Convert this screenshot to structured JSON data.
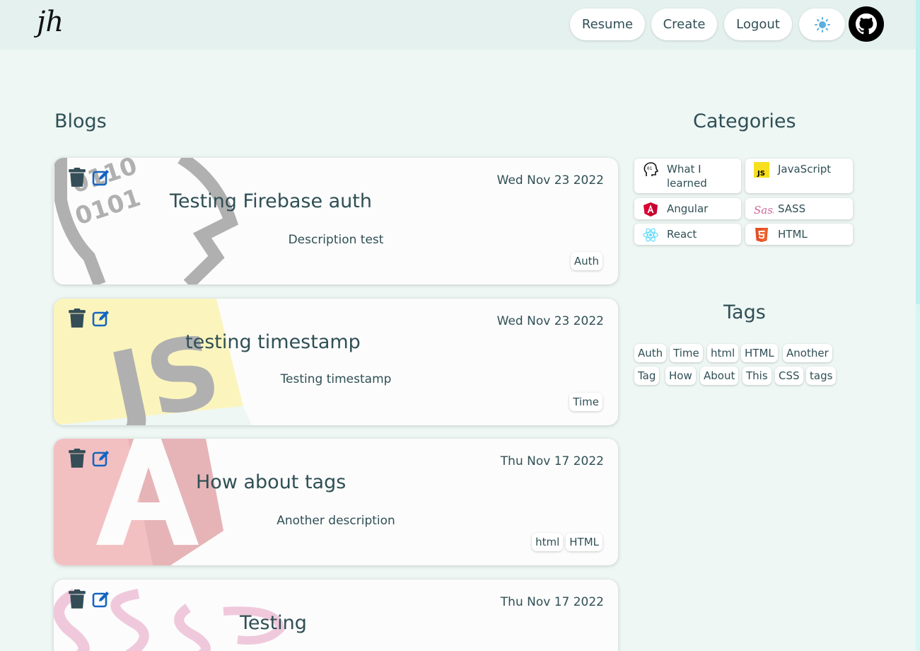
{
  "header": {
    "logo_text": "jh",
    "nav": [
      "Resume",
      "Create",
      "Logout"
    ],
    "theme_icon": "sun-icon",
    "github_icon": "github-icon"
  },
  "blogs": {
    "heading": "Blogs",
    "posts": [
      {
        "title": "Testing Firebase auth",
        "date": "Wed Nov 23 2022",
        "description": "Description test",
        "tags": [
          "Auth"
        ],
        "category": "What I learned"
      },
      {
        "title": "testing timestamp",
        "date": "Wed Nov 23 2022",
        "description": "Testing timestamp",
        "tags": [
          "Time"
        ],
        "category": "JavaScript"
      },
      {
        "title": "How about tags",
        "date": "Thu Nov 17 2022",
        "description": "Another description",
        "tags": [
          "html",
          "HTML"
        ],
        "category": "Angular"
      },
      {
        "title": "Testing",
        "date": "Thu Nov 17 2022",
        "description": "",
        "tags": [],
        "category": "SASS"
      }
    ]
  },
  "categories": {
    "heading": "Categories",
    "items": [
      {
        "label": "What I learned",
        "icon": "brain-head-icon"
      },
      {
        "label": "JavaScript",
        "icon": "javascript-icon"
      },
      {
        "label": "Angular",
        "icon": "angular-icon"
      },
      {
        "label": "SASS",
        "icon": "sass-icon"
      },
      {
        "label": "React",
        "icon": "react-icon"
      },
      {
        "label": "HTML",
        "icon": "html5-icon"
      }
    ]
  },
  "tags": {
    "heading": "Tags",
    "items": [
      "Auth",
      "Time",
      "html",
      "HTML",
      "Another",
      "Tag",
      "How",
      "About",
      "This",
      "CSS",
      "tags"
    ]
  },
  "colors": {
    "page_bg": "#eef7f4",
    "header_bg": "#e5f1ee",
    "text": "#2f4f55",
    "edit_icon": "#1565c0",
    "js_yellow": "#f7df1e",
    "angular_red": "#dd0031",
    "sass_pink": "#cd6799",
    "html_orange": "#e34f26",
    "react_blue": "#61dafb"
  }
}
